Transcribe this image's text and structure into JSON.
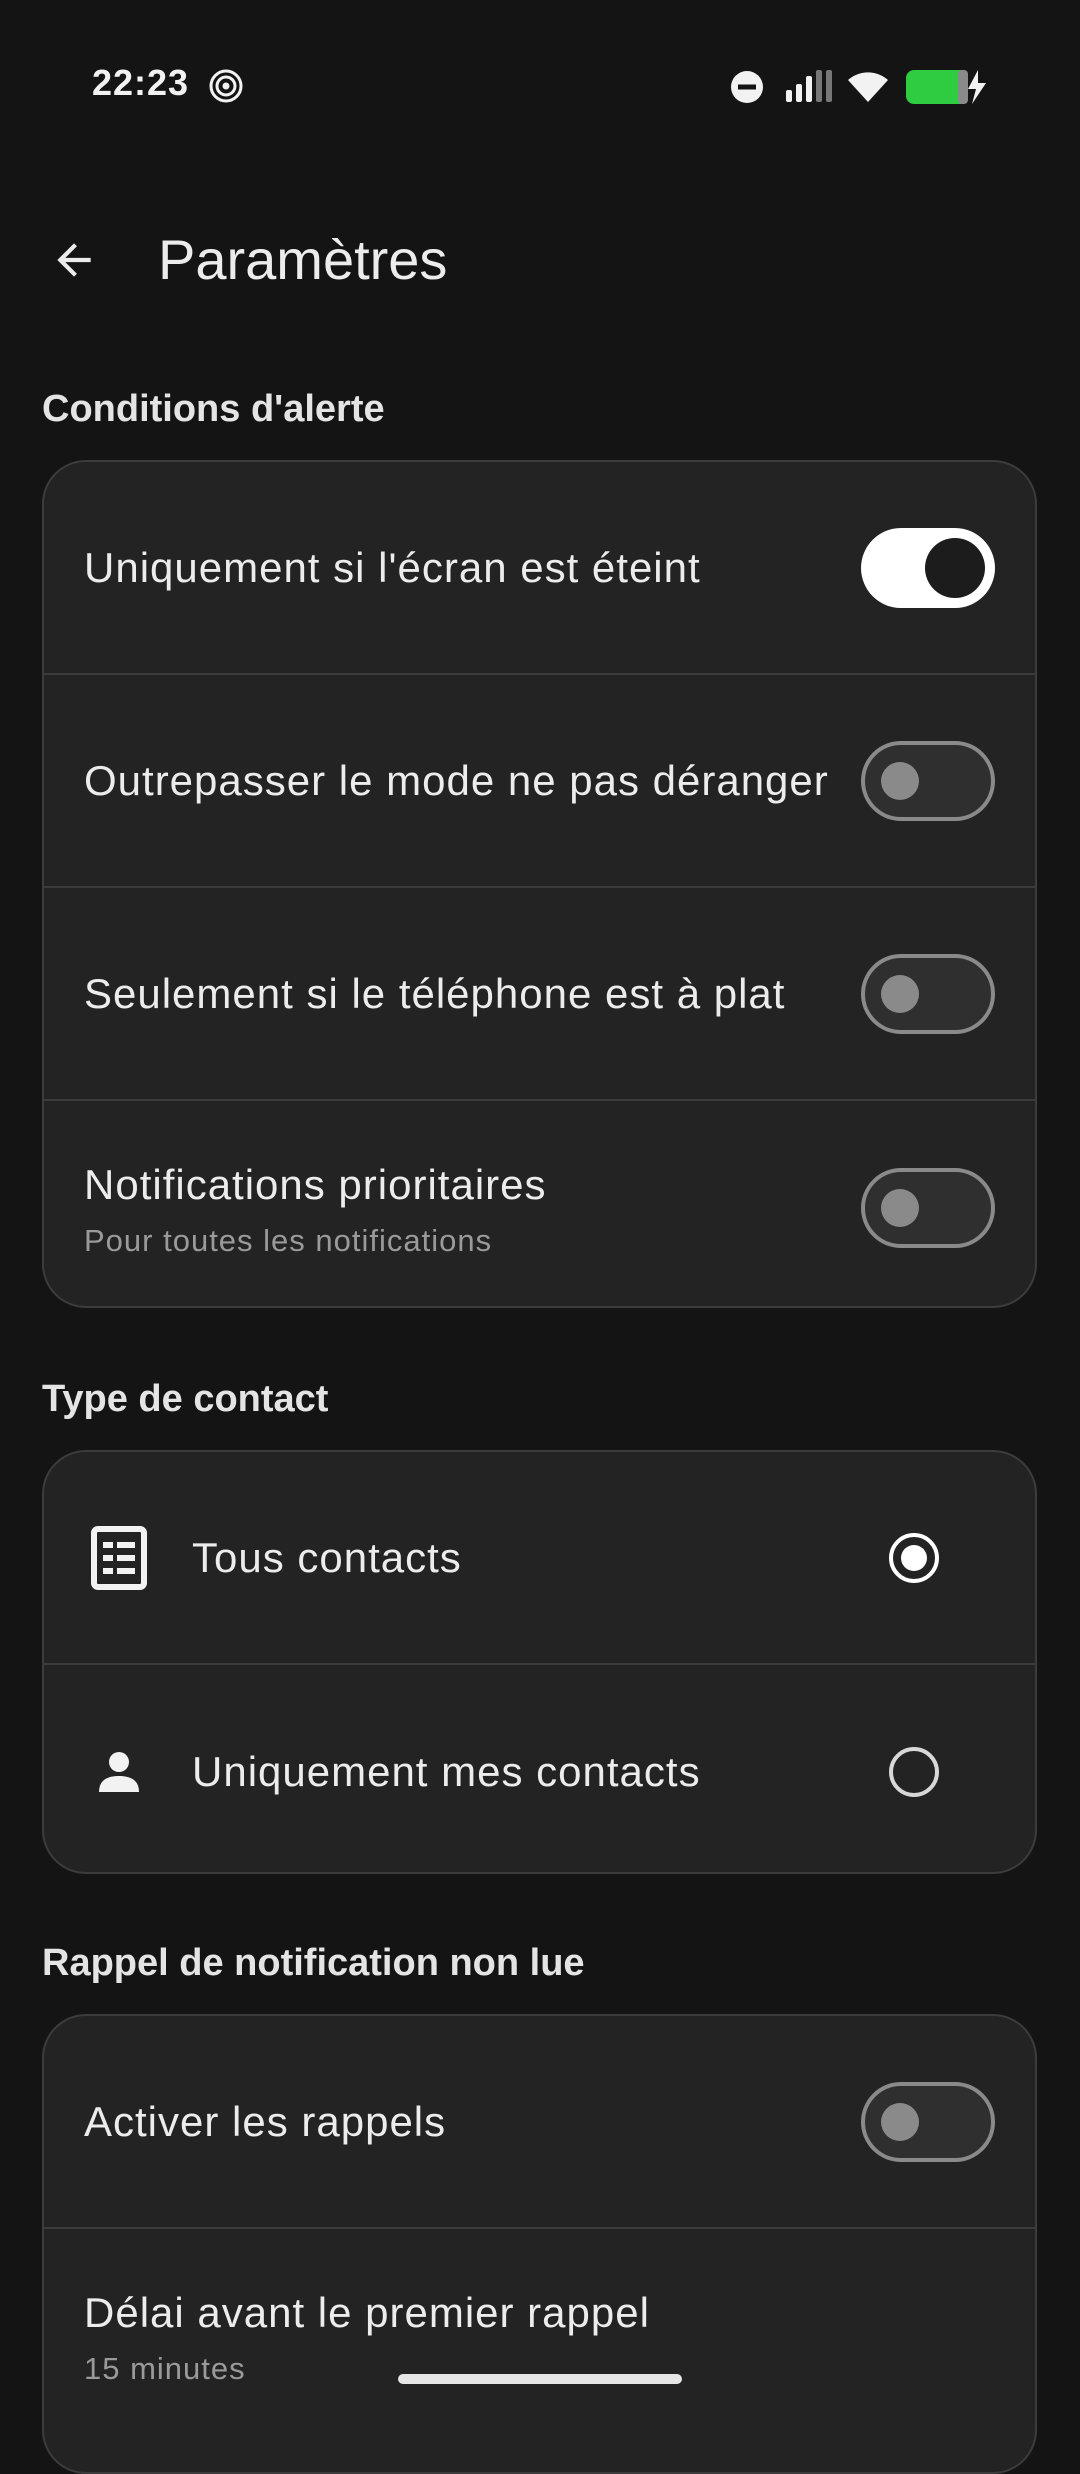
{
  "status_bar": {
    "time": "22:23",
    "icons": [
      "hotspot-icon",
      "dnd-icon",
      "signal-icon",
      "wifi-icon",
      "battery-charging-icon"
    ],
    "battery_color": "#2ecc40"
  },
  "app_bar": {
    "title": "Paramètres",
    "back_icon": "arrow-back-icon"
  },
  "sections": {
    "alert_conditions": {
      "header": "Conditions d'alerte",
      "items": [
        {
          "label": "Uniquement si l'écran est éteint",
          "enabled": true
        },
        {
          "label": "Outrepasser le mode ne pas déranger",
          "enabled": false
        },
        {
          "label": "Seulement si le téléphone est à plat",
          "enabled": false
        },
        {
          "label": "Notifications prioritaires",
          "subtitle": "Pour toutes les notifications",
          "enabled": false
        }
      ]
    },
    "contact_type": {
      "header": "Type de contact",
      "options": [
        {
          "label": "Tous contacts",
          "icon": "contacts-list-icon",
          "selected": true
        },
        {
          "label": "Uniquement mes contacts",
          "icon": "person-icon",
          "selected": false
        }
      ]
    },
    "reminder": {
      "header": "Rappel de notification non lue",
      "items": [
        {
          "label": "Activer les rappels",
          "enabled": false
        },
        {
          "label": "Délai avant le premier rappel",
          "subtitle": "15 minutes"
        }
      ]
    }
  }
}
